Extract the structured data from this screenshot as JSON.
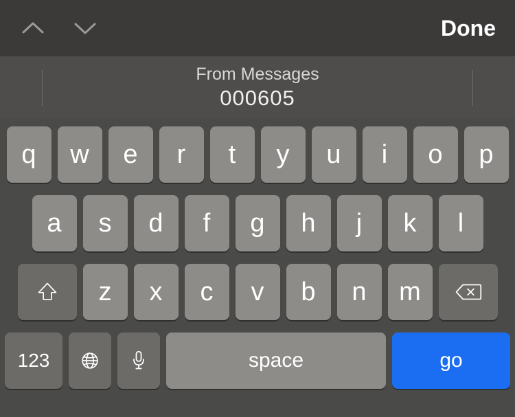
{
  "toolbar": {
    "done_label": "Done"
  },
  "suggestion": {
    "label": "From Messages",
    "code": "000605"
  },
  "keyboard": {
    "row1": [
      "q",
      "w",
      "e",
      "r",
      "t",
      "y",
      "u",
      "i",
      "o",
      "p"
    ],
    "row2": [
      "a",
      "s",
      "d",
      "f",
      "g",
      "h",
      "j",
      "k",
      "l"
    ],
    "row3": [
      "z",
      "x",
      "c",
      "v",
      "b",
      "n",
      "m"
    ],
    "numswitch_label": "123",
    "space_label": "space",
    "go_label": "go"
  }
}
